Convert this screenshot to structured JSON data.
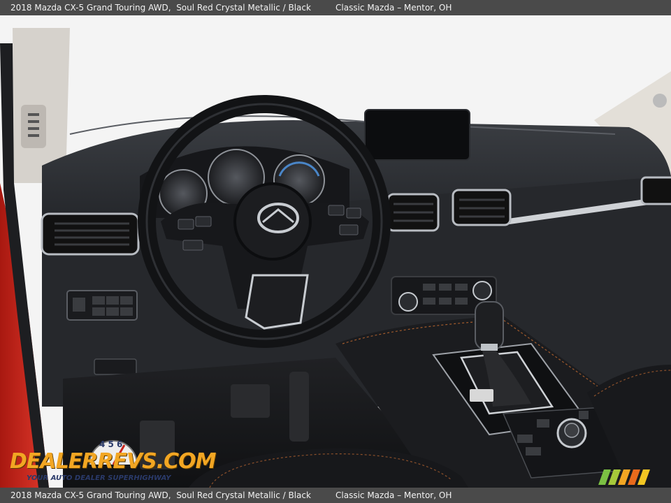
{
  "header": {
    "title": "2018 Mazda CX-5 Grand Touring AWD,  Soul Red Crystal Metallic / Black",
    "dealer": "Classic Mazda – Mentor, OH"
  },
  "footer": {
    "title": "2018 Mazda CX-5 Grand Touring AWD,  Soul Red Crystal Metallic / Black",
    "dealer": "Classic Mazda – Mentor, OH"
  },
  "watermark": {
    "brand": "DEALERREVS.COM",
    "tagline": "YOUR AUTO DEALER SUPERHIGHWAY",
    "gauge_digits": "4 5 6"
  },
  "colors": {
    "bar_bg": "#4a4a4a",
    "bar_text": "#f2f2f2",
    "brand_orange": "#f2a623",
    "body_red": "#c8251e"
  }
}
